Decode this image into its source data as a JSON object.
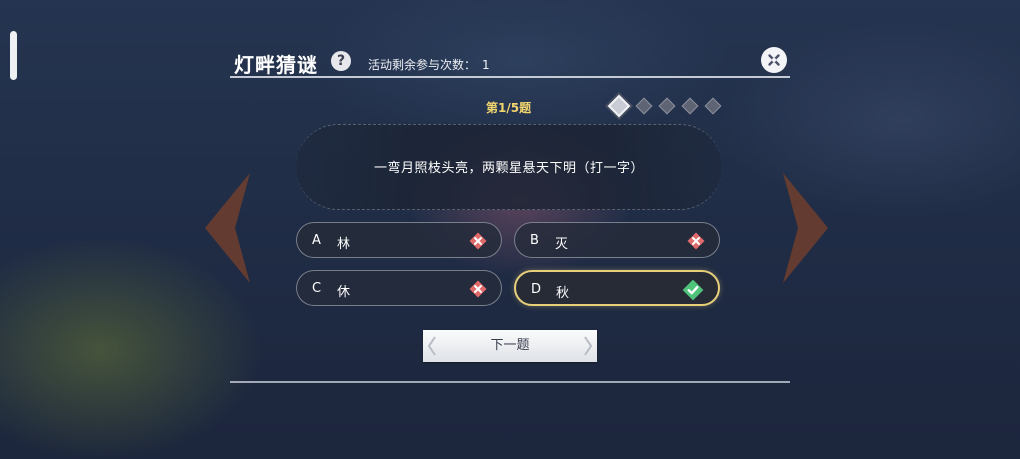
{
  "header": {
    "title": "灯畔猜谜",
    "help_icon": "question-icon",
    "remaining_label": "活动剩余参与次数：",
    "remaining_count": "1",
    "close_icon": "close-icon"
  },
  "quiz": {
    "question_number": "第1/5题",
    "progress": {
      "current": 1,
      "total": 5
    },
    "question": "一弯月照枝头亮，两颗星悬天下明（打一字）",
    "options": [
      {
        "letter": "A",
        "text": "林",
        "result": "wrong",
        "icon": "cross-icon"
      },
      {
        "letter": "B",
        "text": "灭",
        "result": "wrong",
        "icon": "cross-icon"
      },
      {
        "letter": "C",
        "text": "休",
        "result": "wrong",
        "icon": "cross-icon"
      },
      {
        "letter": "D",
        "text": "秋",
        "result": "correct",
        "icon": "check-icon"
      }
    ],
    "next_label": "下一题"
  },
  "colors": {
    "accent_gold": "#e8d07a",
    "question_number": "#f2d56d",
    "wrong": "#e06a6a",
    "correct": "#4fc37a"
  }
}
